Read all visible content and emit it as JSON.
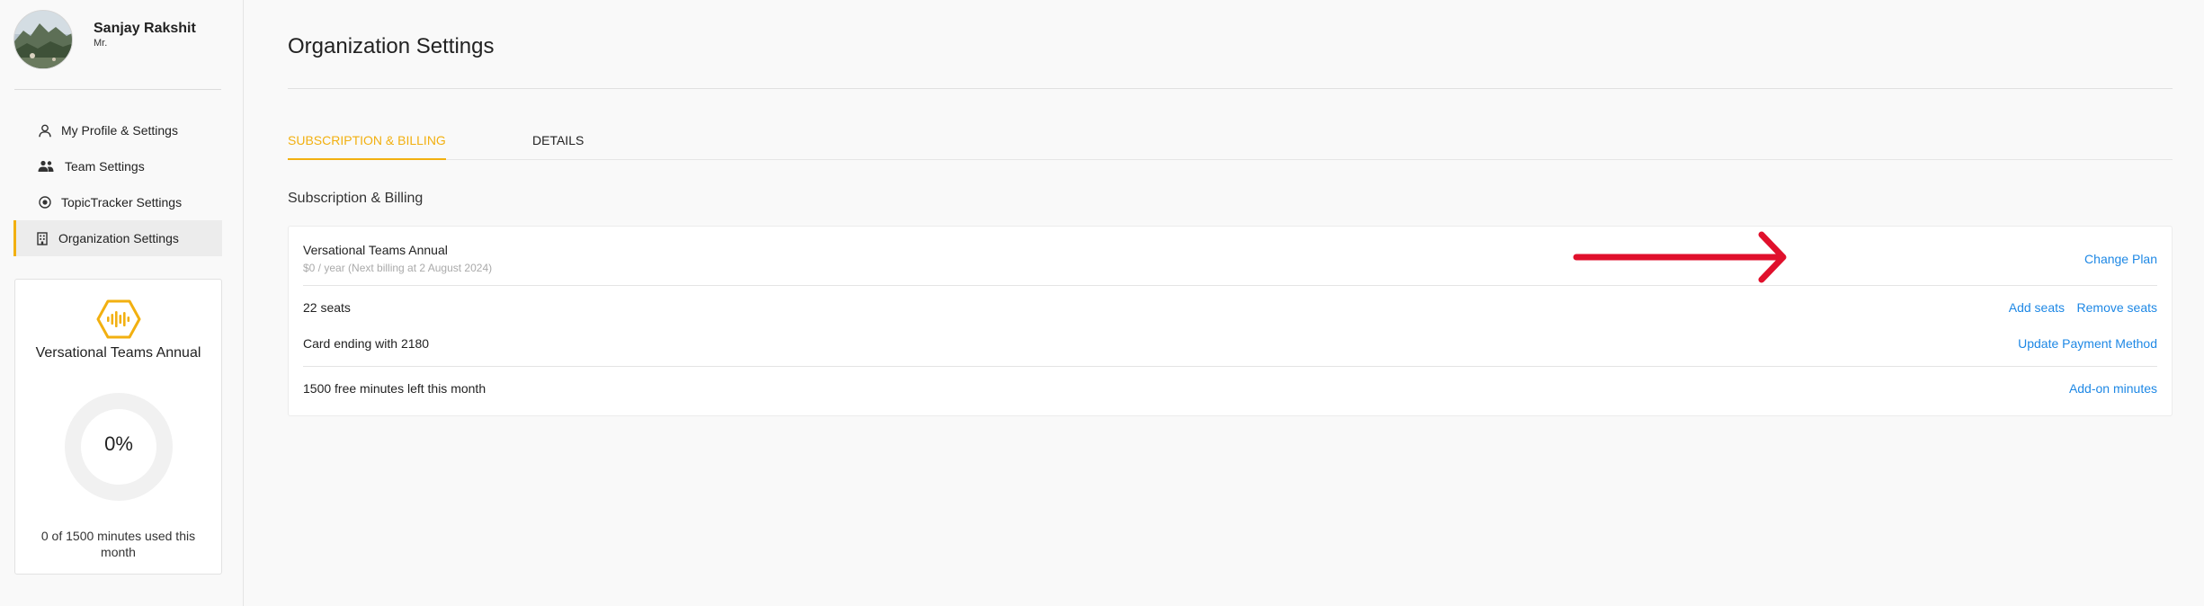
{
  "colors": {
    "accent": "#f2b010",
    "link": "#1e88e5",
    "arrow": "#e0102c"
  },
  "profile": {
    "name": "Sanjay Rakshit",
    "title": "Mr."
  },
  "sidebar": {
    "items": [
      {
        "label": "My Profile & Settings",
        "icon": "person-icon"
      },
      {
        "label": "Team Settings",
        "icon": "team-icon"
      },
      {
        "label": "TopicTracker Settings",
        "icon": "target-icon"
      },
      {
        "label": "Organization Settings",
        "icon": "building-icon",
        "active": true
      }
    ],
    "plan_card": {
      "title": "Versational Teams Annual",
      "usage_percent": "0%",
      "usage_fraction": 0,
      "usage_text": "0 of 1500 minutes used this month"
    }
  },
  "main": {
    "page_title": "Organization Settings",
    "tabs": [
      {
        "label": "SUBSCRIPTION & BILLING",
        "active": true
      },
      {
        "label": "DETAILS",
        "active": false
      }
    ],
    "section_title": "Subscription & Billing",
    "billing": {
      "plan_name": "Versational Teams Annual",
      "plan_price": "$0 / year (Next billing at 2 August 2024)",
      "change_plan": "Change Plan",
      "seats": "22 seats",
      "add_seats": "Add seats",
      "remove_seats": "Remove seats",
      "card": "Card ending with 2180",
      "update_payment": "Update Payment Method",
      "free_minutes": "1500 free minutes left this month",
      "addon_minutes": "Add-on minutes"
    }
  }
}
